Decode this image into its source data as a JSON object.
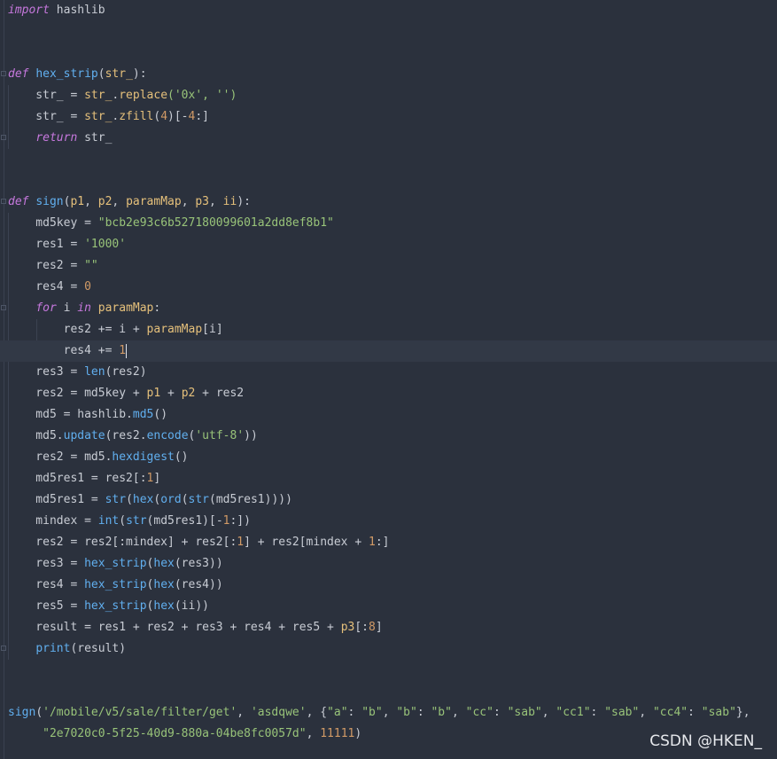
{
  "code": {
    "l1_kw": "import",
    "l1_rest": " hashlib",
    "l4_kw": "def",
    "l4_fn": "hex_strip",
    "l4_p": "str_",
    "l5_a": "    str_ = ",
    "l5_b": "str_",
    "l5_c": ".",
    "l5_d": "replace",
    "l5_e": "('0x', '')",
    "l6_a": "    str_ = ",
    "l6_b": "str_",
    "l6_c": ".",
    "l6_d": "zfill",
    "l6_e": "(",
    "l6_f": "4",
    "l6_g": ")[-",
    "l6_h": "4",
    "l6_i": ":]",
    "l7_kw": "return",
    "l7_rest": " str_",
    "l10_kw": "def",
    "l10_fn": "sign",
    "l10_params": [
      "p1",
      "p2",
      "paramMap",
      "p3",
      "ii"
    ],
    "l11_a": "    md5key = ",
    "l11_s": "\"bcb2e93c6b527180099601a2dd8ef8b1\"",
    "l12_a": "    res1 = ",
    "l12_s": "'1000'",
    "l13_a": "    res2 = ",
    "l13_s": "\"\"",
    "l14_a": "    res4 = ",
    "l14_n": "0",
    "l15_kw1": "for",
    "l15_i": " i ",
    "l15_kw2": "in",
    "l15_p": " paramMap",
    "l15_c": ":",
    "l16_a": "        res2 += i + ",
    "l16_p": "paramMap",
    "l16_b": "[i]",
    "l17_a": "        res4 += ",
    "l17_n": "1",
    "l18_a": "    res3 = ",
    "l18_f": "len",
    "l18_b": "(res2)",
    "l19_a": "    res2 = md5key + ",
    "l19_p1": "p1",
    "l19_b": " + ",
    "l19_p2": "p2",
    "l19_c": " + res2",
    "l20_a": "    md5 = hashlib.",
    "l20_f": "md5",
    "l20_b": "()",
    "l21_a": "    md5.",
    "l21_f": "update",
    "l21_b": "(res2.",
    "l21_f2": "encode",
    "l21_c": "(",
    "l21_s": "'utf-8'",
    "l21_d": "))",
    "l22_a": "    res2 = md5.",
    "l22_f": "hexdigest",
    "l22_b": "()",
    "l23_a": "    md5res1 = res2[:",
    "l23_n": "1",
    "l23_b": "]",
    "l24_a": "    md5res1 = ",
    "l24_f1": "str",
    "l24_b": "(",
    "l24_f2": "hex",
    "l24_c": "(",
    "l24_f3": "ord",
    "l24_d": "(",
    "l24_f4": "str",
    "l24_e": "(md5res1))))",
    "l25_a": "    mindex = ",
    "l25_f1": "int",
    "l25_b": "(",
    "l25_f2": "str",
    "l25_c": "(md5res1)[-",
    "l25_n": "1",
    "l25_d": ":])",
    "l26_a": "    res2 = res2[:mindex] + res2[:",
    "l26_n1": "1",
    "l26_b": "] + res2[mindex + ",
    "l26_n2": "1",
    "l26_c": ":]",
    "l27_a": "    res3 = ",
    "l27_f1": "hex_strip",
    "l27_b": "(",
    "l27_f2": "hex",
    "l27_c": "(res3))",
    "l28_a": "    res4 = ",
    "l28_f1": "hex_strip",
    "l28_b": "(",
    "l28_f2": "hex",
    "l28_c": "(res4))",
    "l29_a": "    res5 = ",
    "l29_f1": "hex_strip",
    "l29_b": "(",
    "l29_f2": "hex",
    "l29_c": "(ii))",
    "l30_a": "    result = res1 + res2 + res3 + res4 + res5 + ",
    "l30_p": "p3",
    "l30_b": "[:",
    "l30_n": "8",
    "l30_c": "]",
    "l31_f": "print",
    "l31_b": "(result)",
    "l34_fn": "sign",
    "l34_a": "(",
    "l34_s1": "'/mobile/v5/sale/filter/get'",
    "l34_b": ", ",
    "l34_s2": "'asdqwe'",
    "l34_c": ", {",
    "l34_dict": [
      {
        "k": "\"a\"",
        "v": "\"b\""
      },
      {
        "k": "\"b\"",
        "v": "\"b\""
      },
      {
        "k": "\"cc\"",
        "v": "\"sab\""
      },
      {
        "k": "\"cc1\"",
        "v": "\"sab\""
      },
      {
        "k": "\"cc4\"",
        "v": "\"sab\""
      }
    ],
    "l34_d": "},",
    "l35_indent": "     ",
    "l35_s": "\"2e7020c0-5f25-40d9-880a-04be8fc0057d\"",
    "l35_b": ", ",
    "l35_n": "11111",
    "l35_c": ")"
  },
  "watermark": "CSDN @HKEN_",
  "colors": {
    "background": "#2b313d",
    "keyword": "#c678dd",
    "function": "#61afef",
    "string": "#98c379",
    "number": "#d19a66",
    "parameter": "#e5c07b",
    "text": "#c8ccd4"
  }
}
